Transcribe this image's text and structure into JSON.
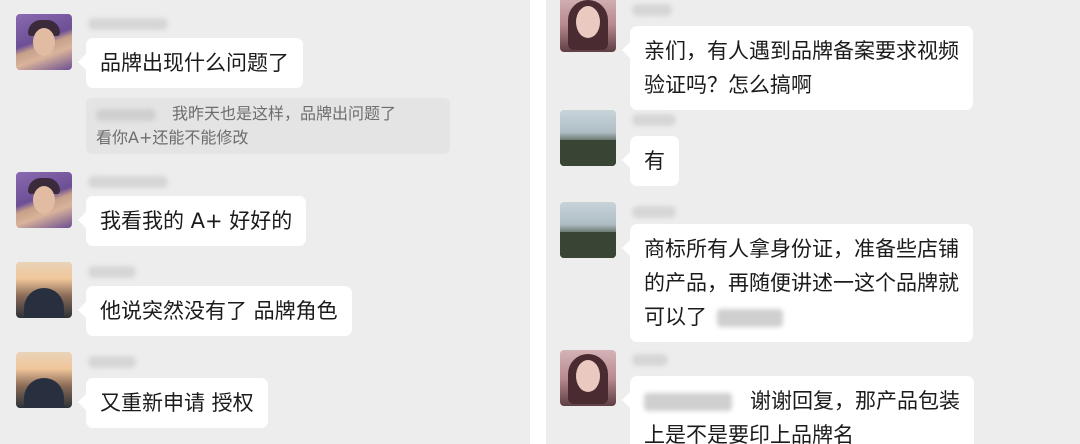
{
  "left_chat": {
    "messages": [
      {
        "text": "品牌出现什么问题了"
      },
      {
        "quote_lines": [
          "我昨天也是这样，品牌出问题了",
          "看你A+还能不能修改"
        ]
      },
      {
        "text": "我看我的 A+ 好好的"
      },
      {
        "text": "他说突然没有了 品牌角色"
      },
      {
        "text": "又重新申请 授权"
      }
    ]
  },
  "right_chat": {
    "messages": [
      {
        "lines": [
          "亲们，有人遇到品牌备案要求视频",
          "验证吗？怎么搞啊"
        ]
      },
      {
        "lines": [
          "有"
        ]
      },
      {
        "lines": [
          "商标所有人拿身份证，准备些店铺",
          "的产品，再随便讲述一这个品牌就",
          "可以了"
        ]
      },
      {
        "lines": [
          "谢谢回复，那产品包装",
          "上是不是要印上品牌名"
        ]
      }
    ]
  },
  "colors": {
    "chat_background": "#ededed",
    "bubble": "#ffffff",
    "quote": "#e4e4e4",
    "divider": "#ffffff"
  }
}
